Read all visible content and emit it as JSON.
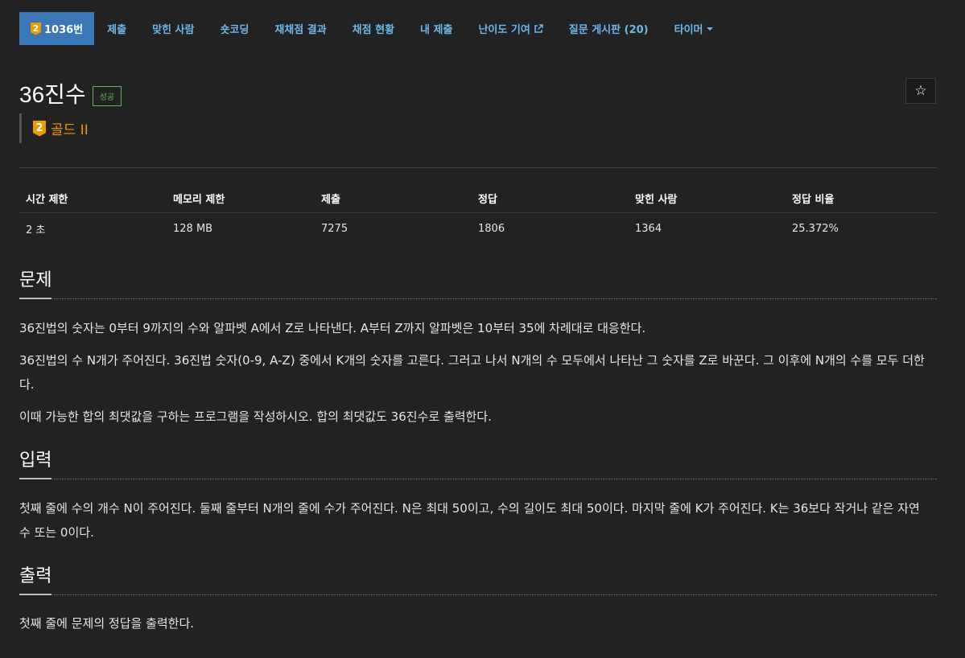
{
  "nav": {
    "problem_tab": {
      "tier_number": "2",
      "label": "1036번"
    },
    "tabs": [
      {
        "name": "tab-submit",
        "label": "제출"
      },
      {
        "name": "tab-solved-users",
        "label": "맞힌 사람"
      },
      {
        "name": "tab-short-coding",
        "label": "숏코딩"
      },
      {
        "name": "tab-rejudge-results",
        "label": "재채점 결과"
      },
      {
        "name": "tab-judge-status",
        "label": "채점 현황"
      },
      {
        "name": "tab-my-submissions",
        "label": "내 제출"
      },
      {
        "name": "tab-difficulty-contrib",
        "label": "난이도 기여",
        "icon": "external-link-icon"
      },
      {
        "name": "tab-qna-board",
        "label": "질문 게시판 (20)"
      },
      {
        "name": "tab-timer",
        "label": "타이머",
        "icon": "caret-down-icon"
      }
    ]
  },
  "problem": {
    "title": "36진수",
    "result": "성공",
    "star_icon": "☆",
    "tier_number": "2",
    "tier_text": "골드 II"
  },
  "info_table": {
    "headers": [
      "시간 제한",
      "메모리 제한",
      "제출",
      "정답",
      "맞힌 사람",
      "정답 비율"
    ],
    "values": [
      "2 초",
      "128 MB",
      "7275",
      "1806",
      "1364",
      "25.372%"
    ]
  },
  "sections": {
    "description": {
      "heading": "문제",
      "paragraphs": [
        "36진법의 숫자는 0부터 9까지의 수와 알파벳 A에서 Z로 나타낸다. A부터 Z까지 알파벳은 10부터 35에 차례대로 대응한다.",
        "36진법의 수 N개가 주어진다. 36진법 숫자(0-9, A-Z) 중에서 K개의 숫자를 고른다. 그러고 나서 N개의 수 모두에서 나타난 그 숫자를 Z로 바꾼다. 그 이후에 N개의 수를 모두 더한다.",
        "이때 가능한 합의 최댓값을 구하는 프로그램을 작성하시오. 합의 최댓값도 36진수로 출력한다."
      ]
    },
    "input": {
      "heading": "입력",
      "paragraphs": [
        "첫째 줄에 수의 개수 N이 주어진다. 둘째 줄부터 N개의 줄에 수가 주어진다. N은 최대 50이고, 수의 길이도 최대 50이다. 마지막 줄에 K가 주어진다. K는 36보다 작거나 같은 자연수 또는 0이다."
      ]
    },
    "output": {
      "heading": "출력",
      "paragraphs": [
        "첫째 줄에 문제의 정답을 출력한다."
      ]
    }
  },
  "colors": {
    "background": "#222222",
    "nav_link": "#6eb7e9",
    "active_tab": "#3b77b6",
    "gold_tier": "#ec9a00",
    "success": "#5cb85c"
  }
}
